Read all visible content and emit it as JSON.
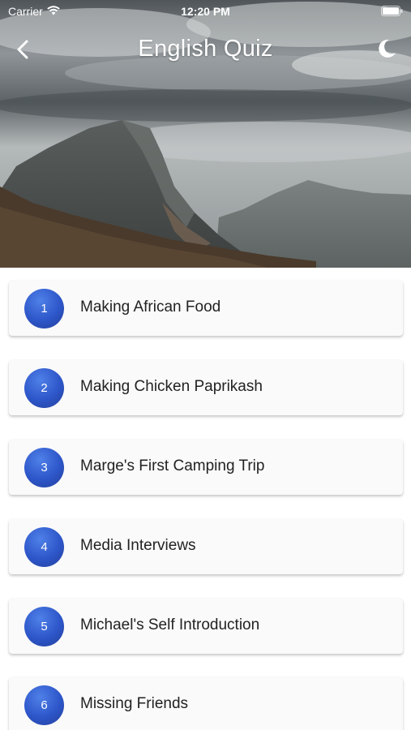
{
  "status_bar": {
    "carrier": "Carrier",
    "time": "12:20 PM"
  },
  "nav": {
    "title": "English Quiz",
    "back_icon": "chevron-left-icon",
    "theme_icon": "moon-icon"
  },
  "quizzes": [
    {
      "number": "1",
      "title": "Making African Food"
    },
    {
      "number": "2",
      "title": "Making Chicken Paprikash"
    },
    {
      "number": "3",
      "title": "Marge's First Camping Trip"
    },
    {
      "number": "4",
      "title": "Media Interviews"
    },
    {
      "number": "5",
      "title": "Michael's Self Introduction"
    },
    {
      "number": "6",
      "title": "Missing Friends"
    }
  ],
  "colors": {
    "badge": "#2d56c9",
    "card": "#fafafa"
  }
}
